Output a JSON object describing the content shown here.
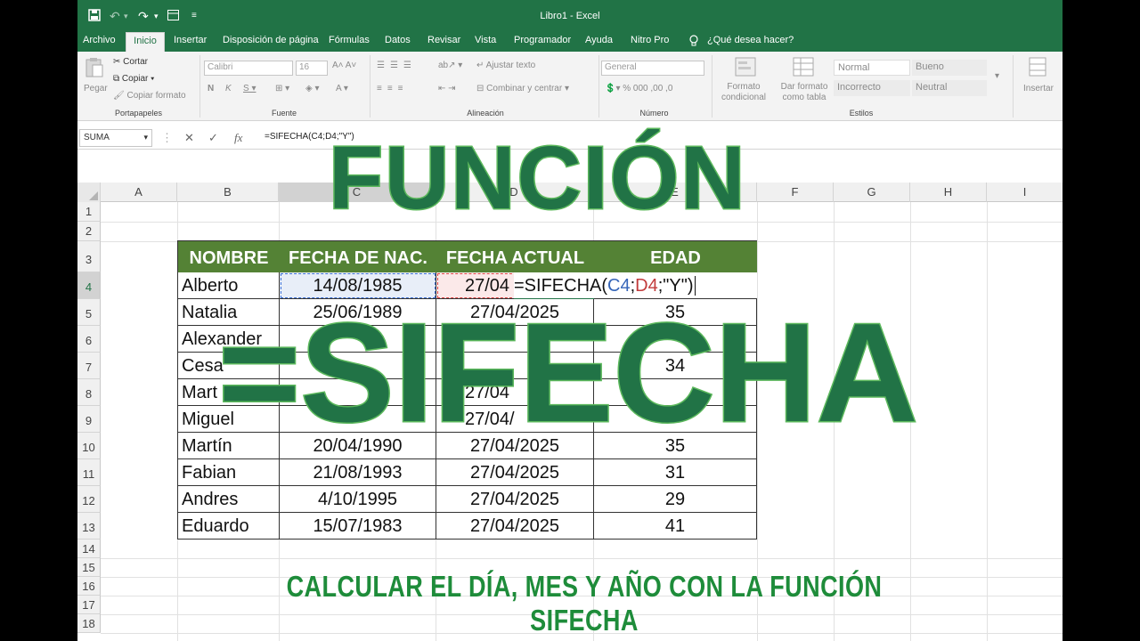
{
  "window": {
    "title": "Libro1  -  Excel"
  },
  "quick_access": {
    "save_icon": "save-icon",
    "undo_icon": "undo-icon",
    "redo_icon": "redo-icon",
    "customize_icon": "customize-icon"
  },
  "tabs": [
    {
      "label": "Archivo"
    },
    {
      "label": "Inicio"
    },
    {
      "label": "Insertar"
    },
    {
      "label": "Disposición de página"
    },
    {
      "label": "Fórmulas"
    },
    {
      "label": "Datos"
    },
    {
      "label": "Revisar"
    },
    {
      "label": "Vista"
    },
    {
      "label": "Programador"
    },
    {
      "label": "Ayuda"
    },
    {
      "label": "Nitro Pro"
    }
  ],
  "tell_me": "¿Qué desea hacer?",
  "ribbon": {
    "clipboard": {
      "paste": "Pegar",
      "cut": "Cortar",
      "copy": "Copiar",
      "format_painter": "Copiar formato",
      "group": "Portapapeles"
    },
    "font": {
      "name": "Calibri",
      "size": "16",
      "group": "Fuente"
    },
    "alignment": {
      "wrap": "Ajustar texto",
      "merge": "Combinar y centrar",
      "group": "Alineación"
    },
    "number": {
      "format": "General",
      "group": "Número"
    },
    "styles": {
      "conditional": "Formato condicional",
      "as_table": "Dar formato como tabla",
      "normal": "Normal",
      "good": "Bueno",
      "bad": "Incorrecto",
      "neutral": "Neutral",
      "group": "Estilos"
    },
    "cells": {
      "insert": "Insertar"
    }
  },
  "formula_bar": {
    "name_box": "SUMA",
    "formula": "=SIFECHA(C4;D4;\"Y\")"
  },
  "columns": [
    "A",
    "B",
    "C",
    "D",
    "E",
    "F",
    "G",
    "H",
    "I"
  ],
  "rows": [
    "1",
    "2",
    "3",
    "4",
    "5",
    "6",
    "7",
    "8",
    "9",
    "10",
    "11",
    "12",
    "13",
    "14",
    "15",
    "16",
    "17",
    "18"
  ],
  "table": {
    "headers": [
      "NOMBRE",
      "FECHA DE NAC.",
      "FECHA ACTUAL",
      "EDAD"
    ],
    "edit_formula": {
      "prefix": "=SIFECHA(",
      "arg1": "C4",
      "sep1": ";",
      "arg2": "D4",
      "rest": ";\"Y\")",
      "d4_visible": "27/04"
    },
    "rows": [
      {
        "name": "Alberto",
        "birth": "14/08/1985",
        "current": "",
        "age": ""
      },
      {
        "name": "Natalia",
        "birth": "25/06/1989",
        "current": "27/04/2025",
        "age": "35"
      },
      {
        "name": "Alexander",
        "birth": "",
        "current": "",
        "age": ""
      },
      {
        "name": "Cesa",
        "birth": "",
        "current": "",
        "age": "34"
      },
      {
        "name": "Mart",
        "birth": "",
        "current": "27/04",
        "age": ""
      },
      {
        "name": "Miguel",
        "birth": "",
        "current": "27/04/",
        "age": ""
      },
      {
        "name": "Martín",
        "birth": "20/04/1990",
        "current": "27/04/2025",
        "age": "35"
      },
      {
        "name": "Fabian",
        "birth": "21/08/1993",
        "current": "27/04/2025",
        "age": "31"
      },
      {
        "name": "Andres",
        "birth": "4/10/1995",
        "current": "27/04/2025",
        "age": "29"
      },
      {
        "name": "Eduardo",
        "birth": "15/07/1983",
        "current": "27/04/2025",
        "age": "41"
      }
    ]
  },
  "overlay": {
    "title": "FUNCIÓN",
    "function": "=SIFECHA",
    "subtitle": "CALCULAR EL DÍA, MES Y AÑO CON LA FUNCIÓN SIFECHA"
  },
  "colors": {
    "excel_green": "#217346",
    "header_green": "#548235",
    "overlay_stroke": "#5cb85c",
    "subtitle": "#1e8c3a"
  }
}
